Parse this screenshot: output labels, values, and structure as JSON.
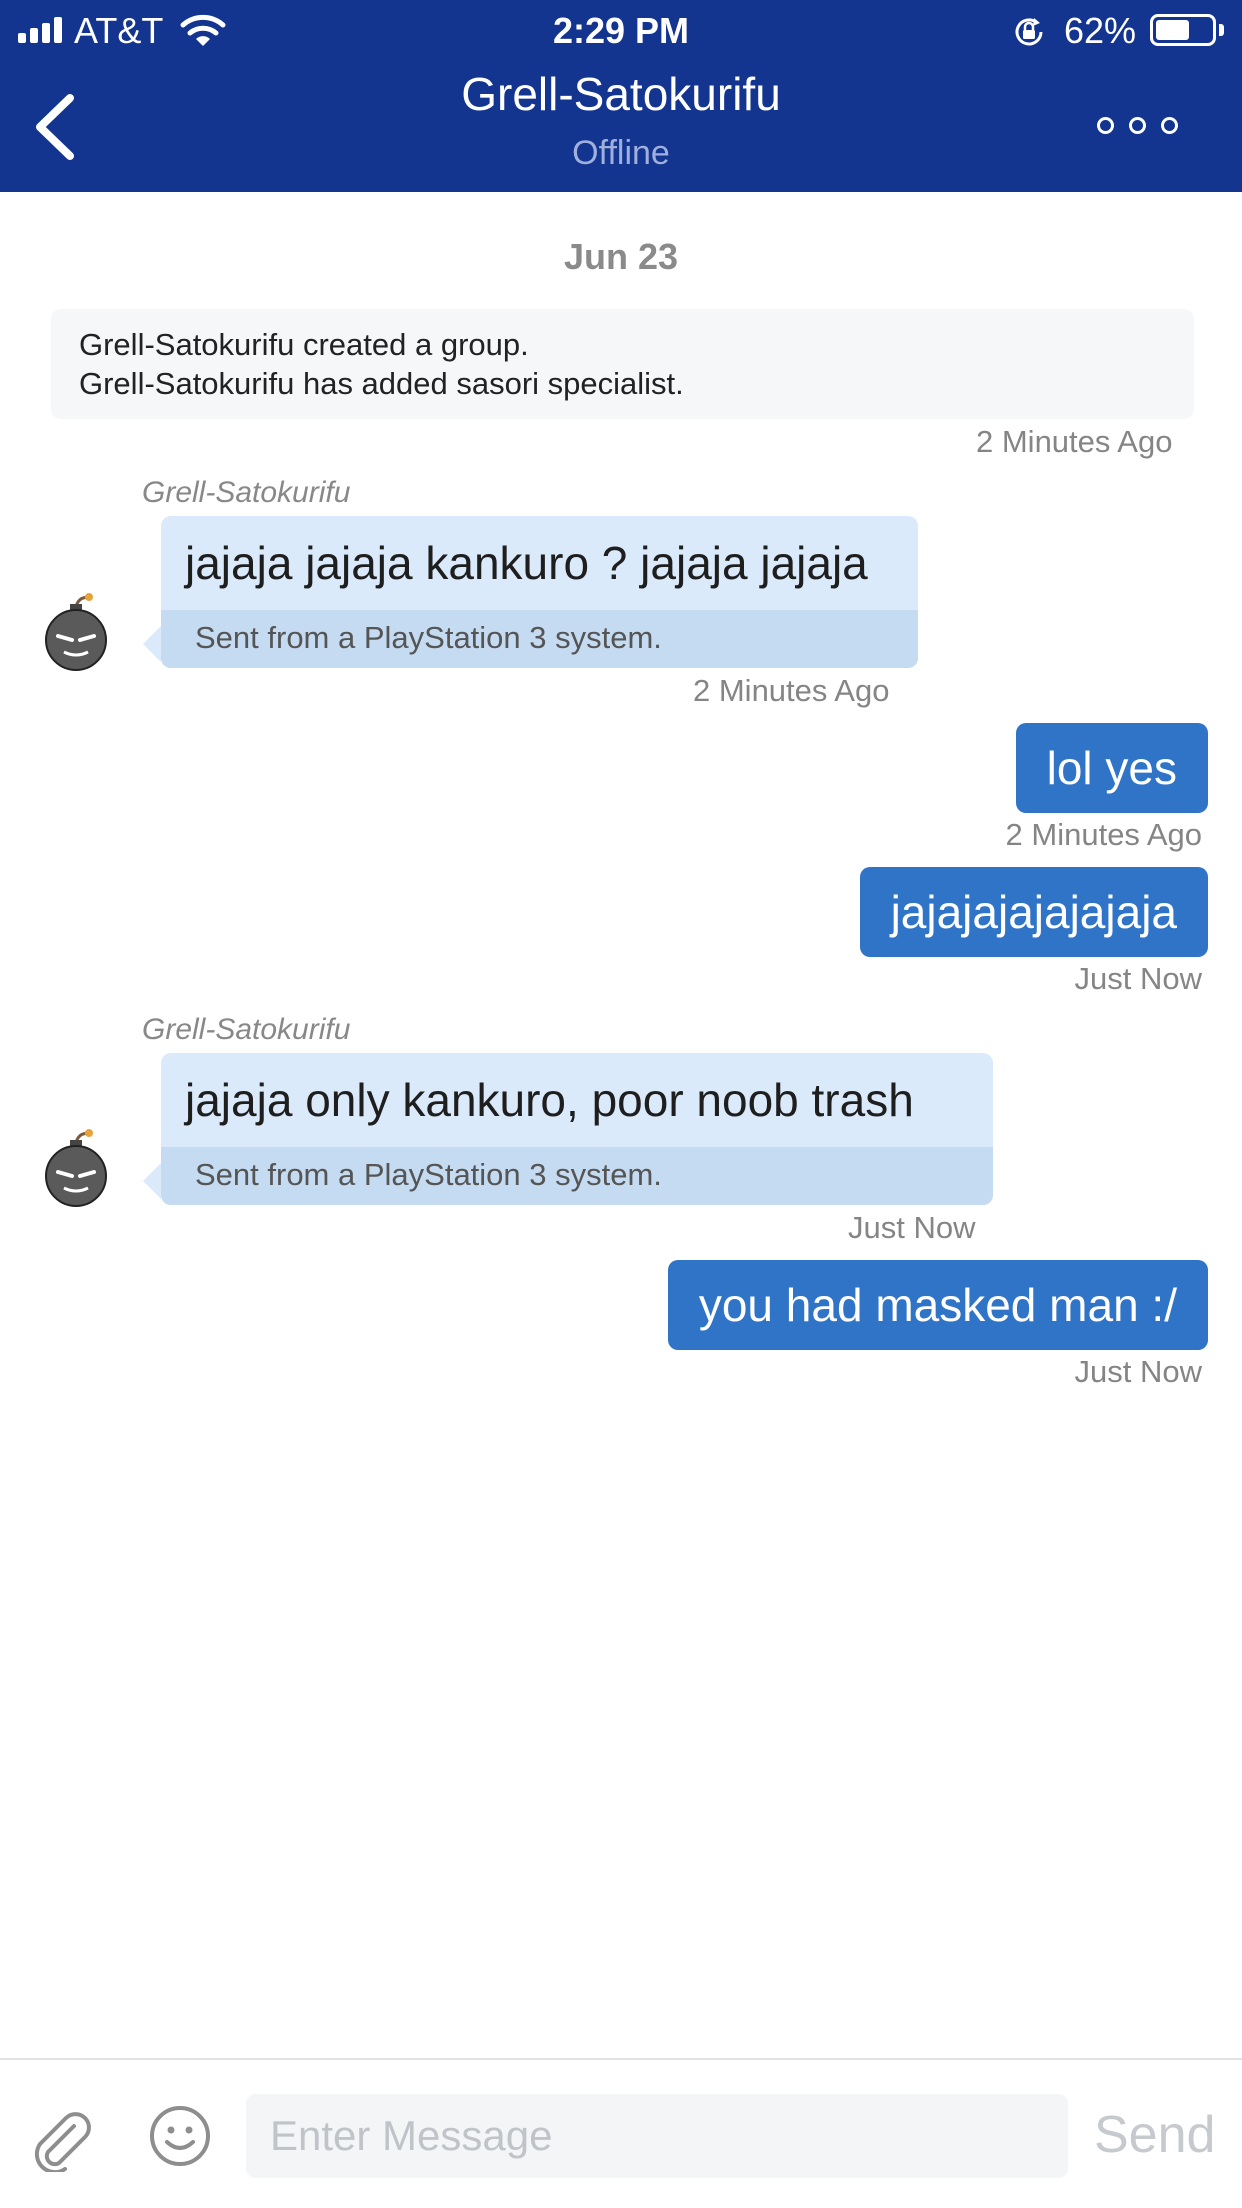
{
  "status_bar": {
    "carrier": "AT&T",
    "time": "2:29 PM",
    "battery_percent_label": "62%",
    "battery_level": 0.62
  },
  "header": {
    "title": "Grell-Satokurifu",
    "subtitle": "Offline",
    "back_icon": "chevron-left-icon",
    "more_icon": "more-dots-icon"
  },
  "chat": {
    "date": "Jun 23",
    "system": {
      "lines": [
        "Grell-Satokurifu created a group.",
        "Grell-Satokurifu has added sasori specialist."
      ],
      "time": "2 Minutes Ago"
    },
    "messages": [
      {
        "direction": "incoming",
        "sender": "Grell-Satokurifu",
        "text": "jajaja jajaja kankuro ? jajaja jajaja",
        "footer": "Sent from a PlayStation 3 system.",
        "time": "2 Minutes Ago"
      },
      {
        "direction": "outgoing",
        "text": "lol yes",
        "time": "2 Minutes Ago"
      },
      {
        "direction": "outgoing",
        "text": "jajajajajajajaja",
        "time": "Just Now"
      },
      {
        "direction": "incoming",
        "sender": "Grell-Satokurifu",
        "text": "jajaja only kankuro, poor noob trash",
        "footer": "Sent from a PlayStation 3 system.",
        "time": "Just Now"
      },
      {
        "direction": "outgoing",
        "text": "you had masked man :/",
        "time": "Just Now"
      }
    ]
  },
  "input_bar": {
    "placeholder": "Enter Message",
    "value": "",
    "send_label": "Send",
    "attach_icon": "paperclip-icon",
    "emoji_icon": "smiley-icon"
  },
  "colors": {
    "header_bg": "#13348f",
    "incoming_bubble": "#dbeafb",
    "incoming_footer": "#c5dbf1",
    "outgoing_bubble": "#2f74c6"
  }
}
